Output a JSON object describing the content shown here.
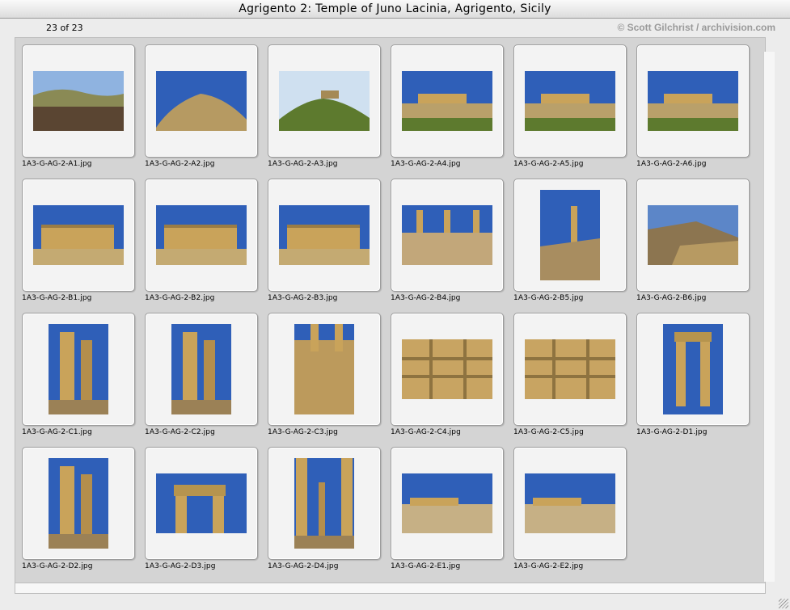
{
  "window": {
    "title": "Agrigento 2: Temple of Juno Lacinia, Agrigento, Sicily"
  },
  "header": {
    "count": "23 of 23",
    "credit": "© Scott Gilchrist / archivision.com"
  },
  "thumbnails": [
    {
      "file": "1A3-G-AG-2-A1.jpg",
      "orientation": "landscape",
      "scene": "field"
    },
    {
      "file": "1A3-G-AG-2-A2.jpg",
      "orientation": "landscape",
      "scene": "hill"
    },
    {
      "file": "1A3-G-AG-2-A3.jpg",
      "orientation": "landscape",
      "scene": "hill-temple"
    },
    {
      "file": "1A3-G-AG-2-A4.jpg",
      "orientation": "landscape",
      "scene": "temple-far"
    },
    {
      "file": "1A3-G-AG-2-A5.jpg",
      "orientation": "landscape",
      "scene": "temple-far"
    },
    {
      "file": "1A3-G-AG-2-A6.jpg",
      "orientation": "landscape",
      "scene": "temple-far"
    },
    {
      "file": "1A3-G-AG-2-B1.jpg",
      "orientation": "landscape",
      "scene": "temple-mid"
    },
    {
      "file": "1A3-G-AG-2-B2.jpg",
      "orientation": "landscape",
      "scene": "temple-mid"
    },
    {
      "file": "1A3-G-AG-2-B3.jpg",
      "orientation": "landscape",
      "scene": "temple-mid"
    },
    {
      "file": "1A3-G-AG-2-B4.jpg",
      "orientation": "landscape",
      "scene": "columns-steps"
    },
    {
      "file": "1A3-G-AG-2-B5.jpg",
      "orientation": "portrait",
      "scene": "single-column"
    },
    {
      "file": "1A3-G-AG-2-B6.jpg",
      "orientation": "landscape",
      "scene": "ridge"
    },
    {
      "file": "1A3-G-AG-2-C1.jpg",
      "orientation": "portrait",
      "scene": "columns-close"
    },
    {
      "file": "1A3-G-AG-2-C2.jpg",
      "orientation": "portrait",
      "scene": "columns-close"
    },
    {
      "file": "1A3-G-AG-2-C3.jpg",
      "orientation": "portrait",
      "scene": "stone-wall"
    },
    {
      "file": "1A3-G-AG-2-C4.jpg",
      "orientation": "landscape",
      "scene": "blocks"
    },
    {
      "file": "1A3-G-AG-2-C5.jpg",
      "orientation": "landscape",
      "scene": "blocks"
    },
    {
      "file": "1A3-G-AG-2-D1.jpg",
      "orientation": "portrait",
      "scene": "arch-portrait"
    },
    {
      "file": "1A3-G-AG-2-D2.jpg",
      "orientation": "portrait",
      "scene": "columns-close"
    },
    {
      "file": "1A3-G-AG-2-D3.jpg",
      "orientation": "landscape",
      "scene": "arch"
    },
    {
      "file": "1A3-G-AG-2-D4.jpg",
      "orientation": "portrait",
      "scene": "colonnade"
    },
    {
      "file": "1A3-G-AG-2-E1.jpg",
      "orientation": "landscape",
      "scene": "ruins-low"
    },
    {
      "file": "1A3-G-AG-2-E2.jpg",
      "orientation": "landscape",
      "scene": "ruins-low"
    }
  ],
  "colors": {
    "sky": "#2f5fb8",
    "stone": "#c9a35a",
    "grass": "#5d7a2e",
    "soil": "#5a4532"
  }
}
